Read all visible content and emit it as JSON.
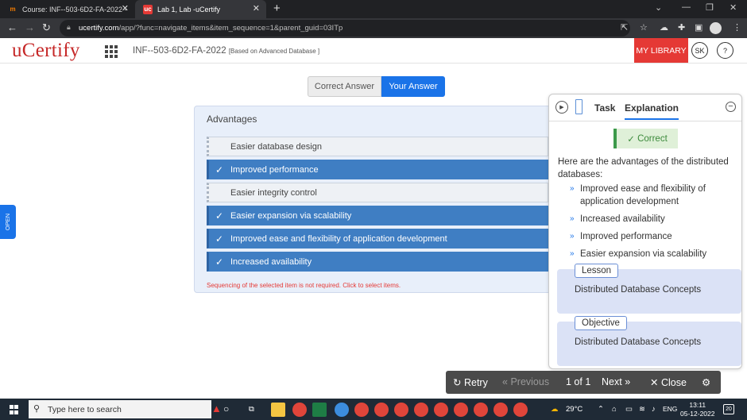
{
  "browser": {
    "tabs": [
      {
        "label": "Course: INF--503-6D2-FA-2022 -",
        "favicon": "m"
      },
      {
        "label": "Lab 1, Lab -uCertify",
        "favicon": "uc"
      }
    ],
    "url_host": "ucertify.com",
    "url_path": "/app/?func=navigate_items&item_sequence=1&parent_guid=03ITp"
  },
  "header": {
    "logo": "uCertify",
    "course": "INF--503-6D2-FA-2022",
    "course_note": "[Based on Advanced Database ]",
    "my_library": "MY LIBRARY",
    "user_initials": "SK",
    "help": "?"
  },
  "toggle": {
    "correct_answer": "Correct Answer",
    "your_answer": "Your Answer"
  },
  "question": {
    "title": "Advantages",
    "items": [
      {
        "label": "Easier database design",
        "selected": false
      },
      {
        "label": "Improved performance",
        "selected": true
      },
      {
        "label": "Easier integrity control",
        "selected": false
      },
      {
        "label": "Easier expansion via scalability",
        "selected": true
      },
      {
        "label": "Improved ease and flexibility of application development",
        "selected": true
      },
      {
        "label": "Increased availability",
        "selected": true
      }
    ],
    "note": "Sequencing of the selected item is not required. Click to select items."
  },
  "side_tab": "OPEN",
  "panel": {
    "tab_task": "Task",
    "tab_explanation": "Explanation",
    "status": "Correct",
    "intro": "Here are the advantages of the distributed databases:",
    "points": [
      "Improved ease and flexibility of application development",
      "Increased availability",
      "Improved performance",
      "Easier expansion via scalability"
    ],
    "lesson_label": "Lesson",
    "lesson_text": "Distributed Database Concepts",
    "objective_label": "Objective",
    "objective_text": "Distributed Database Concepts"
  },
  "bottom_bar": {
    "retry": "Retry",
    "previous": "Previous",
    "page": "1 of 1",
    "next": "Next",
    "close": "Close"
  },
  "taskbar": {
    "search_placeholder": "Type here to search",
    "weather": "29°C",
    "lang": "ENG",
    "time": "13:11",
    "date": "05-12-2022",
    "notifications": "20"
  }
}
